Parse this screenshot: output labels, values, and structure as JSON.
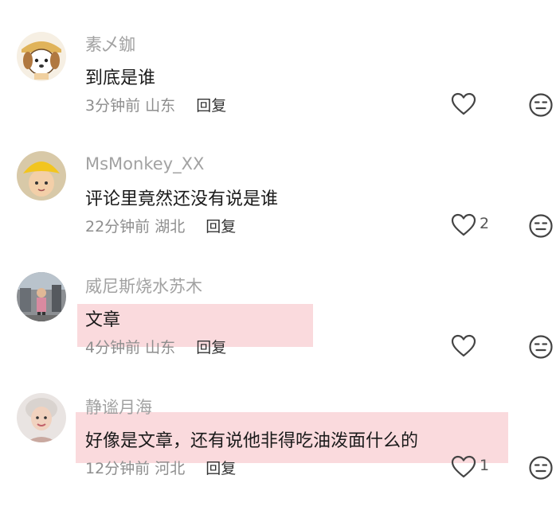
{
  "comments": [
    {
      "username": "素乄鉫",
      "text": "到底是谁",
      "time": "3分钟前",
      "location": "山东",
      "reply_label": "回复",
      "like_count": "",
      "avatar_icon": "dog-cartoon-avatar",
      "highlighted": false
    },
    {
      "username": "MsMonkey_XX",
      "text": "评论里竟然还没有说是谁",
      "time": "22分钟前",
      "location": "湖北",
      "reply_label": "回复",
      "like_count": "2",
      "avatar_icon": "child-yellow-hat-avatar",
      "highlighted": false
    },
    {
      "username": "威尼斯烧水苏木",
      "text": "文章",
      "time": "4分钟前",
      "location": "山东",
      "reply_label": "回复",
      "like_count": "",
      "avatar_icon": "street-photo-avatar",
      "highlighted": true
    },
    {
      "username": "静谧月海",
      "text": "好像是文章，还有说他非得吃油泼面什么的",
      "time": "12分钟前",
      "location": "河北",
      "reply_label": "回复",
      "like_count": "1",
      "avatar_icon": "woman-portrait-avatar",
      "highlighted": true
    }
  ],
  "icons": {
    "like": "heart-outline-icon",
    "emoji": "emoji-face-icon"
  },
  "colors": {
    "highlight": "#fadadd",
    "username": "#a2a2a2",
    "meta": "#8e8e8e"
  }
}
